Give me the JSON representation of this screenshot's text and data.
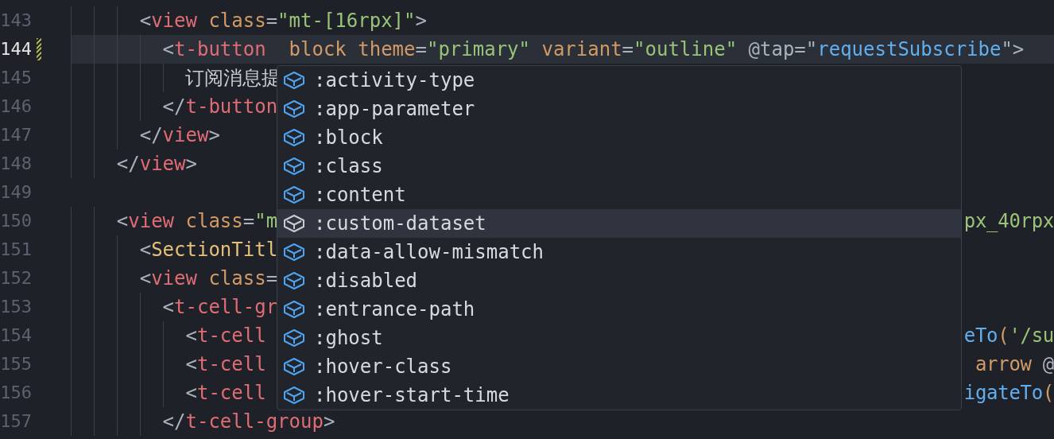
{
  "editor": {
    "lines": [
      {
        "number": "143",
        "active": false,
        "modified": false,
        "segments": [
          {
            "kind": "punct",
            "text": "      <"
          },
          {
            "kind": "tag",
            "text": "view"
          },
          {
            "kind": "attr",
            "text": " class"
          },
          {
            "kind": "punct",
            "text": "="
          },
          {
            "kind": "string",
            "text": "\"mt-[16rpx]\""
          },
          {
            "kind": "punct",
            "text": ">"
          }
        ]
      },
      {
        "number": "144",
        "active": true,
        "modified": true,
        "segments": [
          {
            "kind": "punct",
            "text": "        <"
          },
          {
            "kind": "tag",
            "text": "t-button"
          },
          {
            "kind": "attr",
            "text": "  block theme"
          },
          {
            "kind": "punct",
            "text": "="
          },
          {
            "kind": "string",
            "text": "\"primary\""
          },
          {
            "kind": "attr",
            "text": " variant"
          },
          {
            "kind": "punct",
            "text": "="
          },
          {
            "kind": "string",
            "text": "\"outline\""
          },
          {
            "kind": "punct",
            "text": " @tap=\""
          },
          {
            "kind": "func",
            "text": "requestSubscribe"
          },
          {
            "kind": "punct",
            "text": "\">"
          }
        ]
      },
      {
        "number": "145",
        "active": false,
        "modified": false,
        "segments": [
          {
            "kind": "text",
            "text": "          订阅消息提"
          }
        ]
      },
      {
        "number": "146",
        "active": false,
        "modified": false,
        "segments": [
          {
            "kind": "punct",
            "text": "        </"
          },
          {
            "kind": "tag",
            "text": "t-button"
          }
        ]
      },
      {
        "number": "147",
        "active": false,
        "modified": false,
        "segments": [
          {
            "kind": "punct",
            "text": "      </"
          },
          {
            "kind": "tag",
            "text": "view"
          },
          {
            "kind": "punct",
            "text": ">"
          }
        ]
      },
      {
        "number": "148",
        "active": false,
        "modified": false,
        "segments": [
          {
            "kind": "punct",
            "text": "    </"
          },
          {
            "kind": "tag",
            "text": "view"
          },
          {
            "kind": "punct",
            "text": ">"
          }
        ]
      },
      {
        "number": "149",
        "active": false,
        "modified": false
      },
      {
        "number": "150",
        "active": false,
        "modified": false,
        "segments": [
          {
            "kind": "punct",
            "text": "    <"
          },
          {
            "kind": "tag",
            "text": "view"
          },
          {
            "kind": "attr",
            "text": " class"
          },
          {
            "kind": "punct",
            "text": "="
          },
          {
            "kind": "string",
            "text": "\"m"
          }
        ],
        "right_segments": [
          {
            "kind": "string",
            "text": "px_40rpx"
          }
        ]
      },
      {
        "number": "151",
        "active": false,
        "modified": false,
        "segments": [
          {
            "kind": "punct",
            "text": "      <"
          },
          {
            "kind": "component",
            "text": "SectionTitl"
          }
        ]
      },
      {
        "number": "152",
        "active": false,
        "modified": false,
        "segments": [
          {
            "kind": "punct",
            "text": "      <"
          },
          {
            "kind": "tag",
            "text": "view"
          },
          {
            "kind": "attr",
            "text": " class"
          },
          {
            "kind": "punct",
            "text": "="
          }
        ]
      },
      {
        "number": "153",
        "active": false,
        "modified": false,
        "segments": [
          {
            "kind": "punct",
            "text": "        <"
          },
          {
            "kind": "tag",
            "text": "t-cell-gr"
          }
        ]
      },
      {
        "number": "154",
        "active": false,
        "modified": false,
        "segments": [
          {
            "kind": "punct",
            "text": "          <"
          },
          {
            "kind": "tag",
            "text": "t-cell"
          }
        ],
        "right_segments": [
          {
            "kind": "func",
            "text": "eTo"
          },
          {
            "kind": "attr",
            "text": "("
          },
          {
            "kind": "string",
            "text": "'/su"
          }
        ]
      },
      {
        "number": "155",
        "active": false,
        "modified": false,
        "segments": [
          {
            "kind": "punct",
            "text": "          <"
          },
          {
            "kind": "tag",
            "text": "t-cell"
          }
        ],
        "right_segments": [
          {
            "kind": "attr",
            "text": " arrow"
          },
          {
            "kind": "punct",
            "text": " @"
          }
        ]
      },
      {
        "number": "156",
        "active": false,
        "modified": false,
        "segments": [
          {
            "kind": "punct",
            "text": "          <"
          },
          {
            "kind": "tag",
            "text": "t-cell"
          }
        ],
        "right_segments": [
          {
            "kind": "func",
            "text": "igateTo"
          },
          {
            "kind": "attr",
            "text": "("
          }
        ]
      },
      {
        "number": "157",
        "active": false,
        "modified": false,
        "segments": [
          {
            "kind": "punct",
            "text": "        </"
          },
          {
            "kind": "tag",
            "text": "t-cell-group"
          },
          {
            "kind": "punct",
            "text": ">"
          }
        ]
      }
    ]
  },
  "suggestions": {
    "items": [
      {
        "label": ":activity-type",
        "selected": false
      },
      {
        "label": ":app-parameter",
        "selected": false
      },
      {
        "label": ":block",
        "selected": false
      },
      {
        "label": ":class",
        "selected": false
      },
      {
        "label": ":content",
        "selected": false
      },
      {
        "label": ":custom-dataset",
        "selected": true
      },
      {
        "label": ":data-allow-mismatch",
        "selected": false
      },
      {
        "label": ":disabled",
        "selected": false
      },
      {
        "label": ":entrance-path",
        "selected": false
      },
      {
        "label": ":ghost",
        "selected": false
      },
      {
        "label": ":hover-class",
        "selected": false
      },
      {
        "label": ":hover-start-time",
        "selected": false
      }
    ]
  }
}
